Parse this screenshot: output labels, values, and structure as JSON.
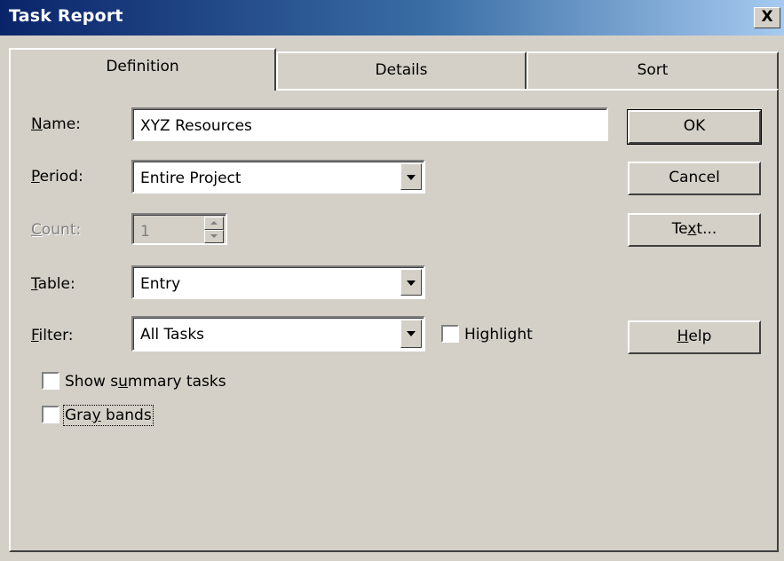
{
  "window": {
    "title": "Task Report",
    "close_label": "X"
  },
  "tabs": [
    {
      "label": "Definition",
      "active": true
    },
    {
      "label": "Details",
      "active": false
    },
    {
      "label": "Sort",
      "active": false
    }
  ],
  "form": {
    "name": {
      "label_key": "N",
      "label_rest": "ame:",
      "value": "XYZ Resources"
    },
    "period": {
      "label_key": "P",
      "label_rest": "eriod:",
      "value": "Entire Project"
    },
    "count": {
      "label_key": "C",
      "label_rest": "ount:",
      "value": "1",
      "enabled": false
    },
    "table": {
      "label_key": "T",
      "label_rest": "able:",
      "value": "Entry"
    },
    "filter": {
      "label_key": "F",
      "label_rest": "ilter:",
      "value": "All Tasks"
    },
    "highlight": {
      "pre": "Hi",
      "key": "g",
      "post": "hlight",
      "checked": false
    },
    "show_summary": {
      "pre": "Show s",
      "key": "u",
      "post": "mmary tasks",
      "checked": false
    },
    "gray_bands": {
      "pre": "Gra",
      "key": "y",
      "post": " bands",
      "checked": false
    }
  },
  "buttons": {
    "ok": "OK",
    "cancel": "Cancel",
    "text_pre": "Te",
    "text_key": "x",
    "text_post": "t...",
    "help_key": "H",
    "help_rest": "elp"
  }
}
